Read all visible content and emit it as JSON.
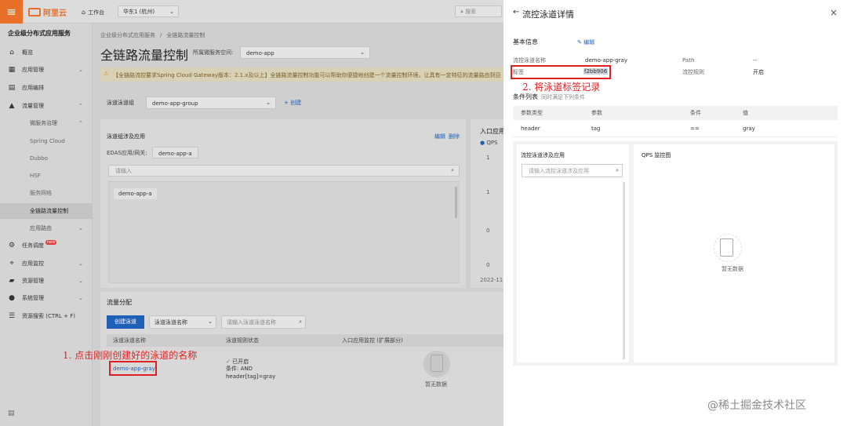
{
  "topbar": {
    "menu_icon": "≡",
    "logo_text": "阿里云",
    "workbench": "工作台",
    "region": "华东1 (杭州)",
    "search_placeholder": "搜索"
  },
  "sidebar": {
    "title": "企业级分布式应用服务",
    "items": [
      {
        "label": "概览"
      },
      {
        "label": "应用管理"
      },
      {
        "label": "应用编排"
      },
      {
        "label": "流量管理"
      },
      {
        "label": "微服务治理"
      },
      {
        "label": "Spring Cloud"
      },
      {
        "label": "Dubbo"
      },
      {
        "label": "HSF"
      },
      {
        "label": "服务网格"
      },
      {
        "label": "全链路流量控制"
      },
      {
        "label": "应用路由"
      },
      {
        "label": "任务调度"
      },
      {
        "label": "应用监控"
      },
      {
        "label": "资源管理"
      },
      {
        "label": "系统管理"
      },
      {
        "label": "资源搜索 (CTRL + F)"
      }
    ],
    "new_badge": "new"
  },
  "main": {
    "breadcrumb": [
      "企业级分布式应用服务",
      "/",
      "全链路流量控制"
    ],
    "page_title": "全链路流量控制",
    "namespace_label": "所属微服务空间:",
    "namespace_value": "demo-app",
    "notice": "【全链路流控要求Spring Cloud Gateway版本：2.1.x及以上】全链路流量控制功能可以帮助你便捷地创建一个流量控制环境，让具有一定特征的流量路由到目标版本",
    "lane_group_label": "泳道泳道组",
    "lane_group_value": "demo-app-group",
    "create_label": "+ 创建",
    "lane_apps_title": "泳道组涉及应用",
    "edit_label": "编辑",
    "delete_label": "删除",
    "edas_label": "EDAS应用/网关:",
    "edas_value": "demo-app-a",
    "search_placeholder": "请输入",
    "app_item": "demo-app-a",
    "entry_title": "入口应用",
    "qps_legend": "QPS",
    "qps_ticks": [
      "1",
      "1",
      "0",
      "0"
    ],
    "time_stub": "2022-11",
    "traffic_title": "流量分配",
    "create_lane_btn": "创建泳道",
    "lane_name_select": "泳道泳道名称",
    "lane_search_placeholder": "请输入泳道泳道名称",
    "table_headers": [
      "泳道泳道名称",
      "泳道规则状态",
      "入口应用监控 (扩展部分)"
    ],
    "row": {
      "name": "demo-app-gray",
      "status": "已开启",
      "cond1": "条件: AND",
      "cond2": "header[tag]=gray"
    },
    "empty_text": "暂无数据"
  },
  "annotations": {
    "step1": "1. 点击刚刚创建好的泳道的名称",
    "step2": "2. 将泳道标签记录"
  },
  "drawer": {
    "back_icon": "←",
    "title": "流控泳道详情",
    "close_icon": "×",
    "basic_info": "基本信息",
    "edit": "编辑",
    "fields": {
      "name_label": "流控泳道名称",
      "name_value": "demo-app-gray",
      "path_label": "Path",
      "path_value": "--",
      "tag_label": "标签",
      "tag_value": "f2bb906",
      "rule_label": "流控规则",
      "rule_value": "开启"
    },
    "cond_title": "条件列表",
    "cond_sub": "同时满足下列条件",
    "cond_headers": [
      "参数类型",
      "参数",
      "条件",
      "值"
    ],
    "cond_row": [
      "header",
      "tag",
      "==",
      "gray"
    ],
    "apps_title": "流控泳道涉及应用",
    "apps_search_placeholder": "请输入流控泳道涉及应用",
    "qps_title": "QPS 监控图",
    "empty_text": "暂无数据"
  },
  "watermark": "@稀土掘金技术社区",
  "colors": {
    "brand_orange": "#e8702a",
    "primary_blue": "#1e5fb8",
    "annotation_red": "#e02020"
  }
}
